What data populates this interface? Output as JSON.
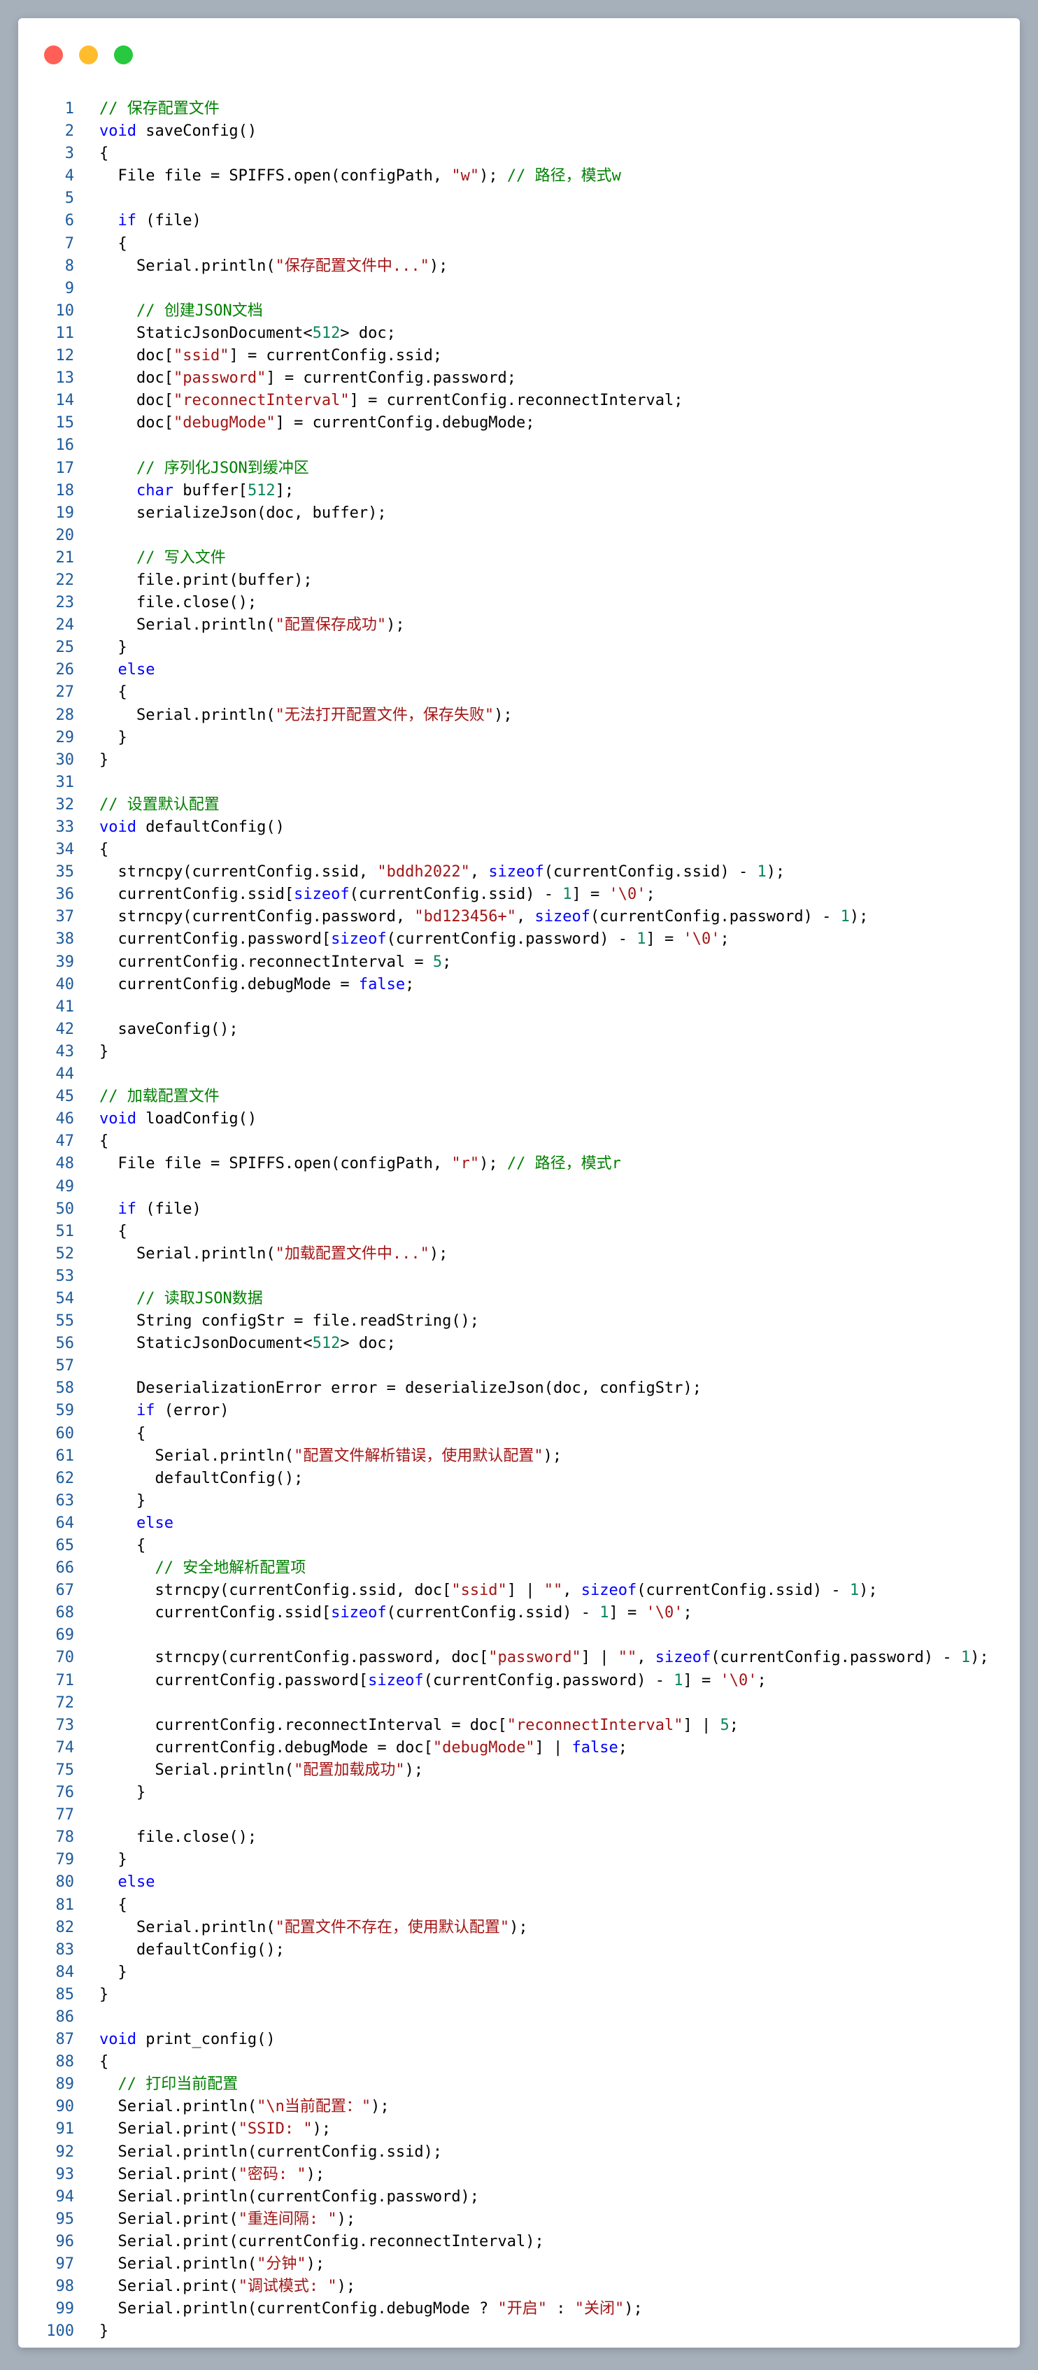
{
  "window": {
    "controls": {
      "close_color": "#ff5f56",
      "minimize_color": "#ffbd2e",
      "zoom_color": "#27c93f"
    }
  },
  "colors": {
    "keyword": "#0000ff",
    "string": "#a31515",
    "comment": "#008000",
    "number": "#098658",
    "line_number": "#1c5a9c"
  },
  "code_lines": [
    [
      [
        "cm",
        "// 保存配置文件"
      ]
    ],
    [
      [
        "kw",
        "void"
      ],
      [
        "t",
        " saveConfig()"
      ]
    ],
    [
      [
        "t",
        "{"
      ]
    ],
    [
      [
        "t",
        "  File file = SPIFFS.open(configPath, "
      ],
      [
        "str",
        "\"w\""
      ],
      [
        "t",
        "); "
      ],
      [
        "cm",
        "// 路径，模式w"
      ]
    ],
    [],
    [
      [
        "t",
        "  "
      ],
      [
        "kw",
        "if"
      ],
      [
        "t",
        " (file)"
      ]
    ],
    [
      [
        "t",
        "  {"
      ]
    ],
    [
      [
        "t",
        "    Serial.println("
      ],
      [
        "str",
        "\"保存配置文件中...\""
      ],
      [
        "t",
        ");"
      ]
    ],
    [],
    [
      [
        "t",
        "    "
      ],
      [
        "cm",
        "// 创建JSON文档"
      ]
    ],
    [
      [
        "t",
        "    StaticJsonDocument<"
      ],
      [
        "num",
        "512"
      ],
      [
        "t",
        "> doc;"
      ]
    ],
    [
      [
        "t",
        "    doc["
      ],
      [
        "str",
        "\"ssid\""
      ],
      [
        "t",
        "] = currentConfig.ssid;"
      ]
    ],
    [
      [
        "t",
        "    doc["
      ],
      [
        "str",
        "\"password\""
      ],
      [
        "t",
        "] = currentConfig.password;"
      ]
    ],
    [
      [
        "t",
        "    doc["
      ],
      [
        "str",
        "\"reconnectInterval\""
      ],
      [
        "t",
        "] = currentConfig.reconnectInterval;"
      ]
    ],
    [
      [
        "t",
        "    doc["
      ],
      [
        "str",
        "\"debugMode\""
      ],
      [
        "t",
        "] = currentConfig.debugMode;"
      ]
    ],
    [],
    [
      [
        "t",
        "    "
      ],
      [
        "cm",
        "// 序列化JSON到缓冲区"
      ]
    ],
    [
      [
        "t",
        "    "
      ],
      [
        "kw",
        "char"
      ],
      [
        "t",
        " buffer["
      ],
      [
        "num",
        "512"
      ],
      [
        "t",
        "];"
      ]
    ],
    [
      [
        "t",
        "    serializeJson(doc, buffer);"
      ]
    ],
    [],
    [
      [
        "t",
        "    "
      ],
      [
        "cm",
        "// 写入文件"
      ]
    ],
    [
      [
        "t",
        "    file.print(buffer);"
      ]
    ],
    [
      [
        "t",
        "    file.close();"
      ]
    ],
    [
      [
        "t",
        "    Serial.println("
      ],
      [
        "str",
        "\"配置保存成功\""
      ],
      [
        "t",
        ");"
      ]
    ],
    [
      [
        "t",
        "  }"
      ]
    ],
    [
      [
        "t",
        "  "
      ],
      [
        "kw",
        "else"
      ]
    ],
    [
      [
        "t",
        "  {"
      ]
    ],
    [
      [
        "t",
        "    Serial.println("
      ],
      [
        "str",
        "\"无法打开配置文件，保存失败\""
      ],
      [
        "t",
        ");"
      ]
    ],
    [
      [
        "t",
        "  }"
      ]
    ],
    [
      [
        "t",
        "}"
      ]
    ],
    [],
    [
      [
        "cm",
        "// 设置默认配置"
      ]
    ],
    [
      [
        "kw",
        "void"
      ],
      [
        "t",
        " defaultConfig()"
      ]
    ],
    [
      [
        "t",
        "{"
      ]
    ],
    [
      [
        "t",
        "  strncpy(currentConfig.ssid, "
      ],
      [
        "str",
        "\"bddh2022\""
      ],
      [
        "t",
        ", "
      ],
      [
        "kw",
        "sizeof"
      ],
      [
        "t",
        "(currentConfig.ssid) - "
      ],
      [
        "num",
        "1"
      ],
      [
        "t",
        ");"
      ]
    ],
    [
      [
        "t",
        "  currentConfig.ssid["
      ],
      [
        "kw",
        "sizeof"
      ],
      [
        "t",
        "(currentConfig.ssid) - "
      ],
      [
        "num",
        "1"
      ],
      [
        "t",
        "] = "
      ],
      [
        "str",
        "'\\0'"
      ],
      [
        "t",
        ";"
      ]
    ],
    [
      [
        "t",
        "  strncpy(currentConfig.password, "
      ],
      [
        "str",
        "\"bd123456+\""
      ],
      [
        "t",
        ", "
      ],
      [
        "kw",
        "sizeof"
      ],
      [
        "t",
        "(currentConfig.password) - "
      ],
      [
        "num",
        "1"
      ],
      [
        "t",
        ");"
      ]
    ],
    [
      [
        "t",
        "  currentConfig.password["
      ],
      [
        "kw",
        "sizeof"
      ],
      [
        "t",
        "(currentConfig.password) - "
      ],
      [
        "num",
        "1"
      ],
      [
        "t",
        "] = "
      ],
      [
        "str",
        "'\\0'"
      ],
      [
        "t",
        ";"
      ]
    ],
    [
      [
        "t",
        "  currentConfig.reconnectInterval = "
      ],
      [
        "num",
        "5"
      ],
      [
        "t",
        ";"
      ]
    ],
    [
      [
        "t",
        "  currentConfig.debugMode = "
      ],
      [
        "kw",
        "false"
      ],
      [
        "t",
        ";"
      ]
    ],
    [],
    [
      [
        "t",
        "  saveConfig();"
      ]
    ],
    [
      [
        "t",
        "}"
      ]
    ],
    [],
    [
      [
        "cm",
        "// 加载配置文件"
      ]
    ],
    [
      [
        "kw",
        "void"
      ],
      [
        "t",
        " loadConfig()"
      ]
    ],
    [
      [
        "t",
        "{"
      ]
    ],
    [
      [
        "t",
        "  File file = SPIFFS.open(configPath, "
      ],
      [
        "str",
        "\"r\""
      ],
      [
        "t",
        "); "
      ],
      [
        "cm",
        "// 路径，模式r"
      ]
    ],
    [],
    [
      [
        "t",
        "  "
      ],
      [
        "kw",
        "if"
      ],
      [
        "t",
        " (file)"
      ]
    ],
    [
      [
        "t",
        "  {"
      ]
    ],
    [
      [
        "t",
        "    Serial.println("
      ],
      [
        "str",
        "\"加载配置文件中...\""
      ],
      [
        "t",
        ");"
      ]
    ],
    [],
    [
      [
        "t",
        "    "
      ],
      [
        "cm",
        "// 读取JSON数据"
      ]
    ],
    [
      [
        "t",
        "    String configStr = file.readString();"
      ]
    ],
    [
      [
        "t",
        "    StaticJsonDocument<"
      ],
      [
        "num",
        "512"
      ],
      [
        "t",
        "> doc;"
      ]
    ],
    [],
    [
      [
        "t",
        "    DeserializationError error = deserializeJson(doc, configStr);"
      ]
    ],
    [
      [
        "t",
        "    "
      ],
      [
        "kw",
        "if"
      ],
      [
        "t",
        " (error)"
      ]
    ],
    [
      [
        "t",
        "    {"
      ]
    ],
    [
      [
        "t",
        "      Serial.println("
      ],
      [
        "str",
        "\"配置文件解析错误，使用默认配置\""
      ],
      [
        "t",
        ");"
      ]
    ],
    [
      [
        "t",
        "      defaultConfig();"
      ]
    ],
    [
      [
        "t",
        "    }"
      ]
    ],
    [
      [
        "t",
        "    "
      ],
      [
        "kw",
        "else"
      ]
    ],
    [
      [
        "t",
        "    {"
      ]
    ],
    [
      [
        "t",
        "      "
      ],
      [
        "cm",
        "// 安全地解析配置项"
      ]
    ],
    [
      [
        "t",
        "      strncpy(currentConfig.ssid, doc["
      ],
      [
        "str",
        "\"ssid\""
      ],
      [
        "t",
        "] | "
      ],
      [
        "str",
        "\"\""
      ],
      [
        "t",
        ", "
      ],
      [
        "kw",
        "sizeof"
      ],
      [
        "t",
        "(currentConfig.ssid) - "
      ],
      [
        "num",
        "1"
      ],
      [
        "t",
        ");"
      ]
    ],
    [
      [
        "t",
        "      currentConfig.ssid["
      ],
      [
        "kw",
        "sizeof"
      ],
      [
        "t",
        "(currentConfig.ssid) - "
      ],
      [
        "num",
        "1"
      ],
      [
        "t",
        "] = "
      ],
      [
        "str",
        "'\\0'"
      ],
      [
        "t",
        ";"
      ]
    ],
    [],
    [
      [
        "t",
        "      strncpy(currentConfig.password, doc["
      ],
      [
        "str",
        "\"password\""
      ],
      [
        "t",
        "] | "
      ],
      [
        "str",
        "\"\""
      ],
      [
        "t",
        ", "
      ],
      [
        "kw",
        "sizeof"
      ],
      [
        "t",
        "(currentConfig.password) - "
      ],
      [
        "num",
        "1"
      ],
      [
        "t",
        ");"
      ]
    ],
    [
      [
        "t",
        "      currentConfig.password["
      ],
      [
        "kw",
        "sizeof"
      ],
      [
        "t",
        "(currentConfig.password) - "
      ],
      [
        "num",
        "1"
      ],
      [
        "t",
        "] = "
      ],
      [
        "str",
        "'\\0'"
      ],
      [
        "t",
        ";"
      ]
    ],
    [],
    [
      [
        "t",
        "      currentConfig.reconnectInterval = doc["
      ],
      [
        "str",
        "\"reconnectInterval\""
      ],
      [
        "t",
        "] | "
      ],
      [
        "num",
        "5"
      ],
      [
        "t",
        ";"
      ]
    ],
    [
      [
        "t",
        "      currentConfig.debugMode = doc["
      ],
      [
        "str",
        "\"debugMode\""
      ],
      [
        "t",
        "] | "
      ],
      [
        "kw",
        "false"
      ],
      [
        "t",
        ";"
      ]
    ],
    [
      [
        "t",
        "      Serial.println("
      ],
      [
        "str",
        "\"配置加载成功\""
      ],
      [
        "t",
        ");"
      ]
    ],
    [
      [
        "t",
        "    }"
      ]
    ],
    [],
    [
      [
        "t",
        "    file.close();"
      ]
    ],
    [
      [
        "t",
        "  }"
      ]
    ],
    [
      [
        "t",
        "  "
      ],
      [
        "kw",
        "else"
      ]
    ],
    [
      [
        "t",
        "  {"
      ]
    ],
    [
      [
        "t",
        "    Serial.println("
      ],
      [
        "str",
        "\"配置文件不存在，使用默认配置\""
      ],
      [
        "t",
        ");"
      ]
    ],
    [
      [
        "t",
        "    defaultConfig();"
      ]
    ],
    [
      [
        "t",
        "  }"
      ]
    ],
    [
      [
        "t",
        "}"
      ]
    ],
    [],
    [
      [
        "kw",
        "void"
      ],
      [
        "t",
        " print_config()"
      ]
    ],
    [
      [
        "t",
        "{"
      ]
    ],
    [
      [
        "t",
        "  "
      ],
      [
        "cm",
        "// 打印当前配置"
      ]
    ],
    [
      [
        "t",
        "  Serial.println("
      ],
      [
        "str",
        "\"\\n当前配置：\""
      ],
      [
        "t",
        ");"
      ]
    ],
    [
      [
        "t",
        "  Serial.print("
      ],
      [
        "str",
        "\"SSID: \""
      ],
      [
        "t",
        ");"
      ]
    ],
    [
      [
        "t",
        "  Serial.println(currentConfig.ssid);"
      ]
    ],
    [
      [
        "t",
        "  Serial.print("
      ],
      [
        "str",
        "\"密码: \""
      ],
      [
        "t",
        ");"
      ]
    ],
    [
      [
        "t",
        "  Serial.println(currentConfig.password);"
      ]
    ],
    [
      [
        "t",
        "  Serial.print("
      ],
      [
        "str",
        "\"重连间隔: \""
      ],
      [
        "t",
        ");"
      ]
    ],
    [
      [
        "t",
        "  Serial.print(currentConfig.reconnectInterval);"
      ]
    ],
    [
      [
        "t",
        "  Serial.println("
      ],
      [
        "str",
        "\"分钟\""
      ],
      [
        "t",
        ");"
      ]
    ],
    [
      [
        "t",
        "  Serial.print("
      ],
      [
        "str",
        "\"调试模式: \""
      ],
      [
        "t",
        ");"
      ]
    ],
    [
      [
        "t",
        "  Serial.println(currentConfig.debugMode ? "
      ],
      [
        "str",
        "\"开启\""
      ],
      [
        "t",
        " : "
      ],
      [
        "str",
        "\"关闭\""
      ],
      [
        "t",
        ");"
      ]
    ],
    [
      [
        "t",
        "}"
      ]
    ]
  ]
}
